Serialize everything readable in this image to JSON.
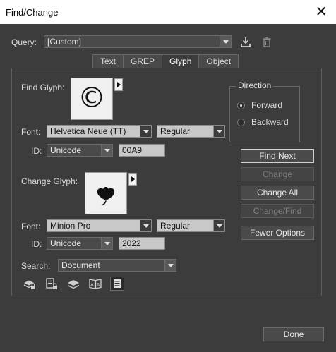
{
  "window": {
    "title": "Find/Change"
  },
  "query": {
    "label": "Query:",
    "value": "[Custom]"
  },
  "tabs": [
    {
      "label": "Text",
      "active": false
    },
    {
      "label": "GREP",
      "active": false
    },
    {
      "label": "Glyph",
      "active": true
    },
    {
      "label": "Object",
      "active": false
    }
  ],
  "find_glyph": {
    "label": "Find Glyph:",
    "glyph": "©",
    "font_label": "Font:",
    "font": "Helvetica Neue (TT)",
    "style": "Regular",
    "id_label": "ID:",
    "id_type": "Unicode",
    "id_value": "00A9"
  },
  "change_glyph": {
    "label": "Change Glyph:",
    "font_label": "Font:",
    "font": "Minion Pro",
    "style": "Regular",
    "id_label": "ID:",
    "id_type": "Unicode",
    "id_value": "2022"
  },
  "search": {
    "label": "Search:",
    "value": "Document"
  },
  "direction": {
    "title": "Direction",
    "options": [
      {
        "label": "Forward",
        "selected": true
      },
      {
        "label": "Backward",
        "selected": false
      }
    ]
  },
  "buttons": {
    "find_next": "Find Next",
    "change": "Change",
    "change_all": "Change All",
    "change_find": "Change/Find",
    "fewer_options": "Fewer Options",
    "done": "Done"
  },
  "icons": {
    "save_query": "save-query-icon",
    "delete_query": "trash-icon",
    "search_options": [
      "locked-layers-icon",
      "locked-stories-icon",
      "hidden-layers-icon",
      "master-pages-icon",
      "footnotes-icon"
    ]
  }
}
